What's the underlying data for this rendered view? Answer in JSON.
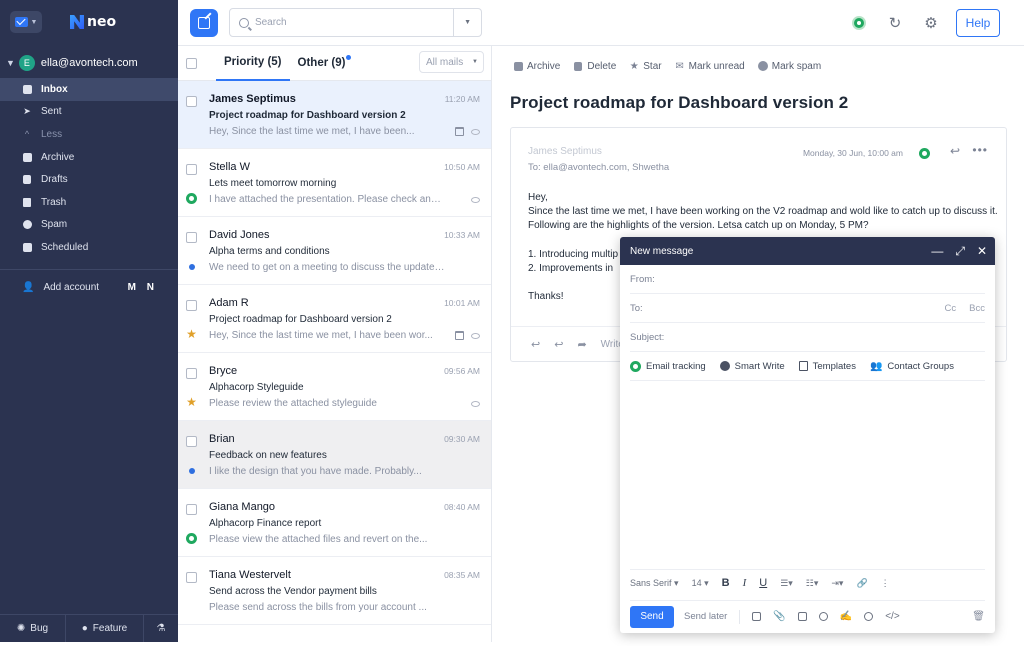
{
  "brand": {
    "name": "neo"
  },
  "account": {
    "email": "ella@avontech.com",
    "avatar_initial": "E"
  },
  "nav": {
    "items": [
      {
        "label": "Inbox",
        "icon": "inbox-icon",
        "active": true
      },
      {
        "label": "Sent",
        "icon": "send-icon"
      },
      {
        "label": "Less",
        "icon": "chevron-up-icon",
        "muted": true
      },
      {
        "label": "Archive",
        "icon": "archive-icon"
      },
      {
        "label": "Drafts",
        "icon": "drafts-icon"
      },
      {
        "label": "Trash",
        "icon": "trash-icon"
      },
      {
        "label": "Spam",
        "icon": "spam-icon"
      },
      {
        "label": "Scheduled",
        "icon": "clock-icon"
      }
    ],
    "add_account": "Add account",
    "add_account_brands": "M N"
  },
  "footer": {
    "bug": "Bug",
    "feature": "Feature"
  },
  "search": {
    "placeholder": "Search"
  },
  "help": "Help",
  "list": {
    "tabs": {
      "priority": "Priority (5)",
      "other": "Other (9)"
    },
    "filter": "All mails",
    "messages": [
      {
        "from": "James Septimus",
        "time": "11:20 AM",
        "subject": "Project roadmap for Dashboard version 2",
        "preview": "Hey, Since the last time we met, I have been...",
        "marker": "",
        "selected": true
      },
      {
        "from": "Stella W",
        "time": "10:50 AM",
        "subject": "Lets meet tomorrow morning",
        "preview": "I have attached the presentation. Please check and l...",
        "marker": "eye"
      },
      {
        "from": "David Jones",
        "time": "10:33 AM",
        "subject": "Alpha terms and conditions",
        "preview": "We need to get on a meeting to discuss the updated ter...",
        "marker": "dot"
      },
      {
        "from": "Adam R",
        "time": "10:01 AM",
        "subject": "Project roadmap for Dashboard version 2",
        "preview": "Hey, Since the last time we met, I have been wor...",
        "marker": "star"
      },
      {
        "from": "Bryce",
        "time": "09:56 AM",
        "subject": "Alphacorp Styleguide",
        "preview": "Please review the attached styleguide",
        "marker": "star"
      },
      {
        "from": "Brian",
        "time": "09:30 AM",
        "subject": "Feedback on new features",
        "preview": "I like the design that you have made. Probably...",
        "marker": "dot",
        "hover": true
      },
      {
        "from": "Giana Mango",
        "time": "08:40 AM",
        "subject": "Alphacorp Finance report",
        "preview": "Please view the attached files and revert on the...",
        "marker": "eye"
      },
      {
        "from": "Tiana Westervelt",
        "time": "08:35 AM",
        "subject": "Send across the Vendor payment bills",
        "preview": "Please send across the bills from your account ...",
        "marker": ""
      }
    ]
  },
  "reader": {
    "toolbar": {
      "archive": "Archive",
      "delete": "Delete",
      "star": "Star",
      "mark_unread": "Mark unread",
      "mark_spam": "Mark spam"
    },
    "title": "Project roadmap for Dashboard version 2",
    "from": "James Septimus",
    "to": "To: ella@avontech.com, Shwetha",
    "date": "Monday, 30 Jun, 10:00 am",
    "body": {
      "greeting": "Hey,",
      "p1": "Since the last time we met, I have been working on the V2 roadmap and wold like to catch up to discuss it. Following are the highlights of the version. Letsa catch up on Monday, 5 PM?",
      "item1": "1. Introducing multip",
      "item2": "2. Improvements in",
      "signoff": "Thanks!"
    },
    "write": "Write"
  },
  "composer": {
    "title": "New message",
    "from_label": "From:",
    "to_label": "To:",
    "cc": "Cc",
    "bcc": "Bcc",
    "subject_label": "Subject:",
    "tools": {
      "tracking": "Email tracking",
      "smart_write": "Smart Write",
      "templates": "Templates",
      "contact_groups": "Contact Groups"
    },
    "format": {
      "font": "Sans Serif",
      "size": "14"
    },
    "send": "Send",
    "send_later": "Send later"
  },
  "colors": {
    "sidebar_bg": "#2b3350",
    "accent": "#2f76f6",
    "tracking_green": "#1fa85f",
    "star": "#e0a02a"
  }
}
